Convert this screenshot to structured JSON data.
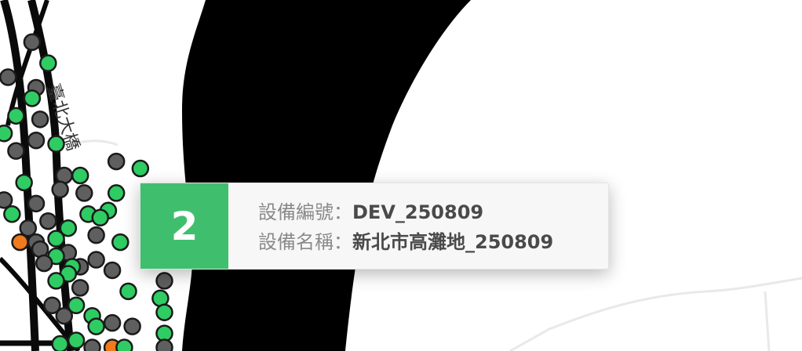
{
  "map": {
    "road_label": "臺北大橋",
    "markers": [
      {
        "lat": 0.12,
        "lng": 0.04,
        "status": "offline"
      },
      {
        "lat": 0.18,
        "lng": 0.06,
        "status": "online"
      },
      {
        "lat": 0.22,
        "lng": 0.01,
        "status": "offline"
      },
      {
        "lat": 0.25,
        "lng": 0.045,
        "status": "offline"
      },
      {
        "lat": 0.28,
        "lng": 0.04,
        "status": "online"
      },
      {
        "lat": 0.33,
        "lng": 0.02,
        "status": "online"
      },
      {
        "lat": 0.34,
        "lng": 0.05,
        "status": "offline"
      },
      {
        "lat": 0.38,
        "lng": 0.005,
        "status": "online"
      },
      {
        "lat": 0.4,
        "lng": 0.045,
        "status": "offline"
      },
      {
        "lat": 0.41,
        "lng": 0.07,
        "status": "online"
      },
      {
        "lat": 0.43,
        "lng": 0.02,
        "status": "offline"
      },
      {
        "lat": 0.46,
        "lng": 0.145,
        "status": "offline"
      },
      {
        "lat": 0.48,
        "lng": 0.175,
        "status": "online"
      },
      {
        "lat": 0.5,
        "lng": 0.08,
        "status": "offline"
      },
      {
        "lat": 0.5,
        "lng": 0.1,
        "status": "online"
      },
      {
        "lat": 0.52,
        "lng": 0.03,
        "status": "online"
      },
      {
        "lat": 0.54,
        "lng": 0.075,
        "status": "offline"
      },
      {
        "lat": 0.55,
        "lng": 0.145,
        "status": "online"
      },
      {
        "lat": 0.55,
        "lng": 0.105,
        "status": "offline"
      },
      {
        "lat": 0.57,
        "lng": 0.005,
        "status": "offline"
      },
      {
        "lat": 0.58,
        "lng": 0.045,
        "status": "offline"
      },
      {
        "lat": 0.6,
        "lng": 0.135,
        "status": "online"
      },
      {
        "lat": 0.61,
        "lng": 0.015,
        "status": "online"
      },
      {
        "lat": 0.61,
        "lng": 0.11,
        "status": "online"
      },
      {
        "lat": 0.62,
        "lng": 0.125,
        "status": "online"
      },
      {
        "lat": 0.63,
        "lng": 0.06,
        "status": "offline"
      },
      {
        "lat": 0.65,
        "lng": 0.035,
        "status": "offline"
      },
      {
        "lat": 0.65,
        "lng": 0.085,
        "status": "online"
      },
      {
        "lat": 0.67,
        "lng": 0.12,
        "status": "offline"
      },
      {
        "lat": 0.68,
        "lng": 0.07,
        "status": "online"
      },
      {
        "lat": 0.69,
        "lng": 0.025,
        "status": "warning"
      },
      {
        "lat": 0.69,
        "lng": 0.15,
        "status": "online"
      },
      {
        "lat": 0.69,
        "lng": 0.045,
        "status": "offline"
      },
      {
        "lat": 0.71,
        "lng": 0.05,
        "status": "offline"
      },
      {
        "lat": 0.72,
        "lng": 0.085,
        "status": "offline"
      },
      {
        "lat": 0.73,
        "lng": 0.07,
        "status": "online"
      },
      {
        "lat": 0.74,
        "lng": 0.12,
        "status": "offline"
      },
      {
        "lat": 0.75,
        "lng": 0.055,
        "status": "offline"
      },
      {
        "lat": 0.76,
        "lng": 0.1,
        "status": "offline"
      },
      {
        "lat": 0.76,
        "lng": 0.09,
        "status": "online"
      },
      {
        "lat": 0.77,
        "lng": 0.14,
        "status": "offline"
      },
      {
        "lat": 0.78,
        "lng": 0.085,
        "status": "online"
      },
      {
        "lat": 0.8,
        "lng": 0.07,
        "status": "online"
      },
      {
        "lat": 0.8,
        "lng": 0.205,
        "status": "offline"
      },
      {
        "lat": 0.82,
        "lng": 0.1,
        "status": "offline"
      },
      {
        "lat": 0.83,
        "lng": 0.16,
        "status": "online"
      },
      {
        "lat": 0.85,
        "lng": 0.2,
        "status": "online"
      },
      {
        "lat": 0.87,
        "lng": 0.065,
        "status": "offline"
      },
      {
        "lat": 0.87,
        "lng": 0.095,
        "status": "online"
      },
      {
        "lat": 0.89,
        "lng": 0.205,
        "status": "online"
      },
      {
        "lat": 0.9,
        "lng": 0.08,
        "status": "offline"
      },
      {
        "lat": 0.9,
        "lng": 0.115,
        "status": "online"
      },
      {
        "lat": 0.92,
        "lng": 0.14,
        "status": "offline"
      },
      {
        "lat": 0.93,
        "lng": 0.165,
        "status": "offline"
      },
      {
        "lat": 0.93,
        "lng": 0.12,
        "status": "online"
      },
      {
        "lat": 0.95,
        "lng": 0.205,
        "status": "online"
      },
      {
        "lat": 0.97,
        "lng": 0.095,
        "status": "online"
      },
      {
        "lat": 0.98,
        "lng": 0.075,
        "status": "online"
      },
      {
        "lat": 0.99,
        "lng": 0.115,
        "status": "offline"
      },
      {
        "lat": 0.99,
        "lng": 0.14,
        "status": "warning"
      },
      {
        "lat": 0.99,
        "lng": 0.155,
        "status": "online"
      },
      {
        "lat": 0.99,
        "lng": 0.205,
        "status": "offline"
      }
    ]
  },
  "colors": {
    "online": "#2ecc63",
    "offline": "#5f5f5f",
    "warning": "#f07a1c",
    "river": "#000000",
    "badge": "#3fbf6d"
  },
  "popup": {
    "cluster_count": "2",
    "device_id_label": "設備編號：",
    "device_id_value": "DEV_250809",
    "device_name_label": "設備名稱：",
    "device_name_value": "新北市高灘地_250809"
  }
}
